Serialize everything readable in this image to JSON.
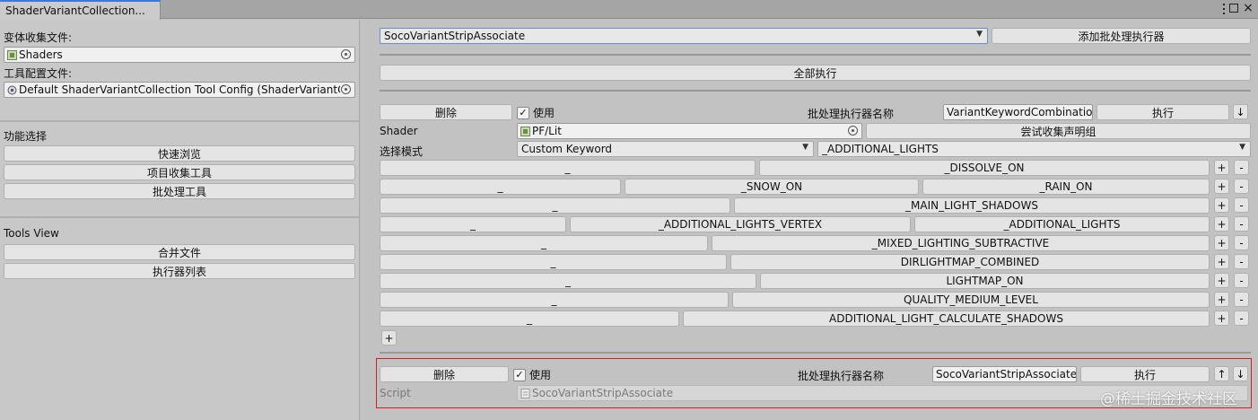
{
  "window": {
    "tab_title": "ShaderVariantCollection...",
    "menu_icon": "kebab-menu-icon",
    "controls": [
      "maximize-icon",
      "close-icon"
    ]
  },
  "left": {
    "collection_label": "变体收集文件:",
    "collection_value": "Shaders",
    "config_label": "工具配置文件:",
    "config_value": "Default ShaderVariantCollection Tool Config (ShaderVariantColl",
    "function_title": "功能选择",
    "function_buttons": [
      "快速浏览",
      "项目收集工具",
      "批处理工具"
    ],
    "tools_view_title": "Tools View",
    "tools_buttons": [
      "合并文件",
      "执行器列表"
    ]
  },
  "top": {
    "dropdown_value": "SocoVariantStripAssociate",
    "add_button": "添加批处理执行器",
    "run_all_button": "全部执行"
  },
  "executor1": {
    "delete_label": "删除",
    "use_checked": true,
    "use_label": "使用",
    "name_label": "批处理执行器名称",
    "name_value": "VariantKeywordCombination",
    "run_label": "执行",
    "down_arrow": "↓",
    "shader_label": "Shader",
    "shader_value": "PF/Lit",
    "try_collect_button": "尝试收集声明组",
    "mode_label": "选择模式",
    "mode_value": "Custom Keyword",
    "keyword_dropdown": "_ADDITIONAL_LIGHTS",
    "keyword_rows": [
      [
        "_",
        "_DISSOLVE_ON"
      ],
      [
        "_",
        "_SNOW_ON",
        "_RAIN_ON"
      ],
      [
        "_",
        "_MAIN_LIGHT_SHADOWS"
      ],
      [
        "_",
        "_ADDITIONAL_LIGHTS_VERTEX",
        "_ADDITIONAL_LIGHTS"
      ],
      [
        "_",
        "_MIXED_LIGHTING_SUBTRACTIVE"
      ],
      [
        "_",
        "DIRLIGHTMAP_COMBINED"
      ],
      [
        "_",
        "LIGHTMAP_ON"
      ],
      [
        "_",
        "QUALITY_MEDIUM_LEVEL"
      ],
      [
        "_",
        "ADDITIONAL_LIGHT_CALCULATE_SHADOWS"
      ]
    ],
    "plus": "+",
    "minus": "-",
    "add_row": "+"
  },
  "executor2": {
    "delete_label": "删除",
    "use_checked": true,
    "use_label": "使用",
    "name_label": "批处理执行器名称",
    "name_value": "SocoVariantStripAssociate",
    "run_label": "执行",
    "up_arrow": "↑",
    "down_arrow": "↓",
    "script_label": "Script",
    "script_value": "SocoVariantStripAssociate"
  },
  "watermark": "@稀土掘金技术社区",
  "colors": {
    "highlight_border": "#d0201f",
    "panel": "#c8c8c8",
    "button": "#e4e4e4"
  }
}
